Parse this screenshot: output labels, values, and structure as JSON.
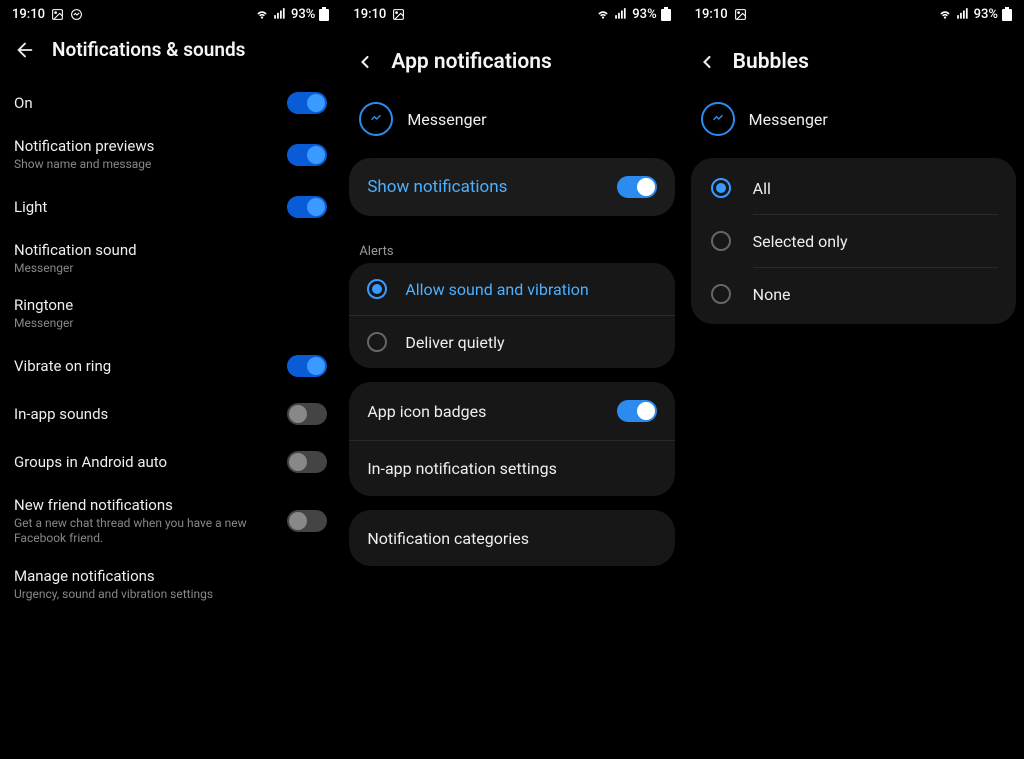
{
  "status": {
    "time": "19:10",
    "battery": "93%"
  },
  "panel1": {
    "title": "Notifications & sounds",
    "rows": {
      "on": {
        "label": "On"
      },
      "previews": {
        "label": "Notification previews",
        "sub": "Show name and message"
      },
      "light": {
        "label": "Light"
      },
      "sound": {
        "label": "Notification sound",
        "sub": "Messenger"
      },
      "ringtone": {
        "label": "Ringtone",
        "sub": "Messenger"
      },
      "vibrate": {
        "label": "Vibrate on ring"
      },
      "inapp": {
        "label": "In-app sounds"
      },
      "groups": {
        "label": "Groups in Android auto"
      },
      "newfriend": {
        "label": "New friend notifications",
        "sub": "Get a new chat thread when you have a new Facebook friend."
      },
      "manage": {
        "label": "Manage notifications",
        "sub": "Urgency, sound and vibration settings"
      }
    }
  },
  "panel2": {
    "title": "App notifications",
    "app": "Messenger",
    "shownotif": "Show notifications",
    "alerts": "Alerts",
    "allow": "Allow sound and vibration",
    "quiet": "Deliver quietly",
    "badges": "App icon badges",
    "inapp": "In-app notification settings",
    "categories": "Notification categories"
  },
  "panel3": {
    "title": "Bubbles",
    "app": "Messenger",
    "opts": {
      "all": "All",
      "selected": "Selected only",
      "none": "None"
    }
  }
}
